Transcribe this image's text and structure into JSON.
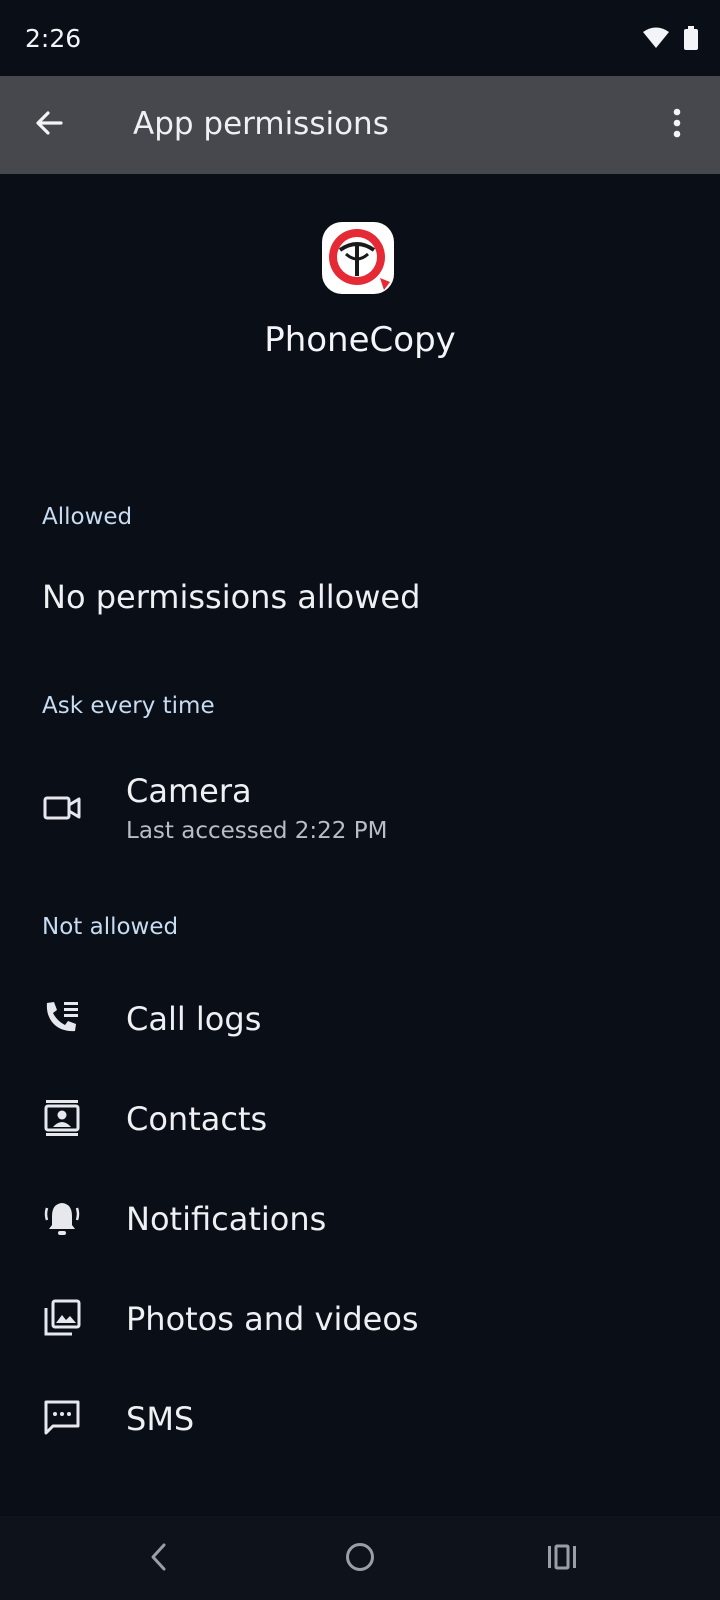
{
  "status_bar": {
    "time": "2:26",
    "icons": [
      "wifi-icon",
      "battery-icon"
    ]
  },
  "app_bar": {
    "title": "App permissions",
    "back_icon": "arrow-back-icon",
    "more_icon": "more-vert-icon"
  },
  "app": {
    "name": "PhoneCopy",
    "icon": "phonecopy-logo-icon"
  },
  "sections": {
    "allowed": {
      "title": "Allowed",
      "empty_text": "No permissions allowed"
    },
    "ask_every_time": {
      "title": "Ask every time",
      "items": [
        {
          "label": "Camera",
          "subtitle": "Last accessed 2:22 PM",
          "icon": "camera-icon"
        }
      ]
    },
    "not_allowed": {
      "title": "Not allowed",
      "items": [
        {
          "label": "Call logs",
          "icon": "call-log-icon"
        },
        {
          "label": "Contacts",
          "icon": "contacts-icon"
        },
        {
          "label": "Notifications",
          "icon": "notifications-icon"
        },
        {
          "label": "Photos and videos",
          "icon": "photos-icon"
        },
        {
          "label": "SMS",
          "icon": "sms-icon"
        }
      ]
    }
  },
  "nav_bar": {
    "buttons": [
      "back-nav-icon",
      "home-nav-icon",
      "recents-nav-icon"
    ]
  },
  "colors": {
    "background": "#0a0e16",
    "app_bar": "#46484d",
    "section_title": "#c7dcf2",
    "logo_red": "#e52a35"
  }
}
